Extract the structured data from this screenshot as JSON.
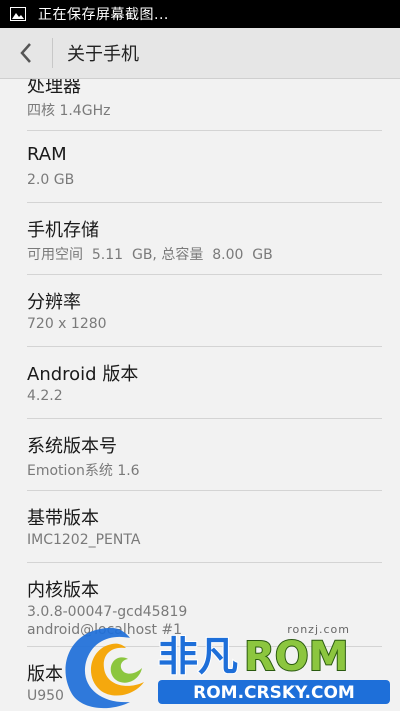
{
  "status_bar": {
    "text": "正在保存屏幕截图..."
  },
  "action_bar": {
    "title": "关于手机"
  },
  "items": [
    {
      "title": "处理器",
      "summary": "四核 1.4GHz"
    },
    {
      "title": "RAM",
      "summary": "2.0 GB"
    },
    {
      "title": "手机存储",
      "summary": "可用空间  5.11  GB, 总容量  8.00  GB"
    },
    {
      "title": "分辨率",
      "summary": "720 x 1280"
    },
    {
      "title": "Android 版本",
      "summary": "4.2.2"
    },
    {
      "title": "系统版本号",
      "summary": "Emotion系统 1.6"
    },
    {
      "title": "基带版本",
      "summary": "IMC1202_PENTA"
    },
    {
      "title": "内核版本",
      "summary": "3.0.8-00047-gcd45819",
      "summary2": "android@localhost #1"
    },
    {
      "title": "版本",
      "summary": "U950"
    }
  ],
  "watermark": {
    "site": "ronzj.com",
    "brand_cn": "非凡",
    "brand_en": "ROM",
    "url": "ROM.CRSKY.COM"
  },
  "colors": {
    "status_bg": "#000000",
    "action_bar_bg": "#e6e6e6",
    "page_bg": "#f2f2f2",
    "divider": "#d4d4d4",
    "brand_green": "#8cc63f",
    "brand_blue": "#1e6fd9"
  }
}
